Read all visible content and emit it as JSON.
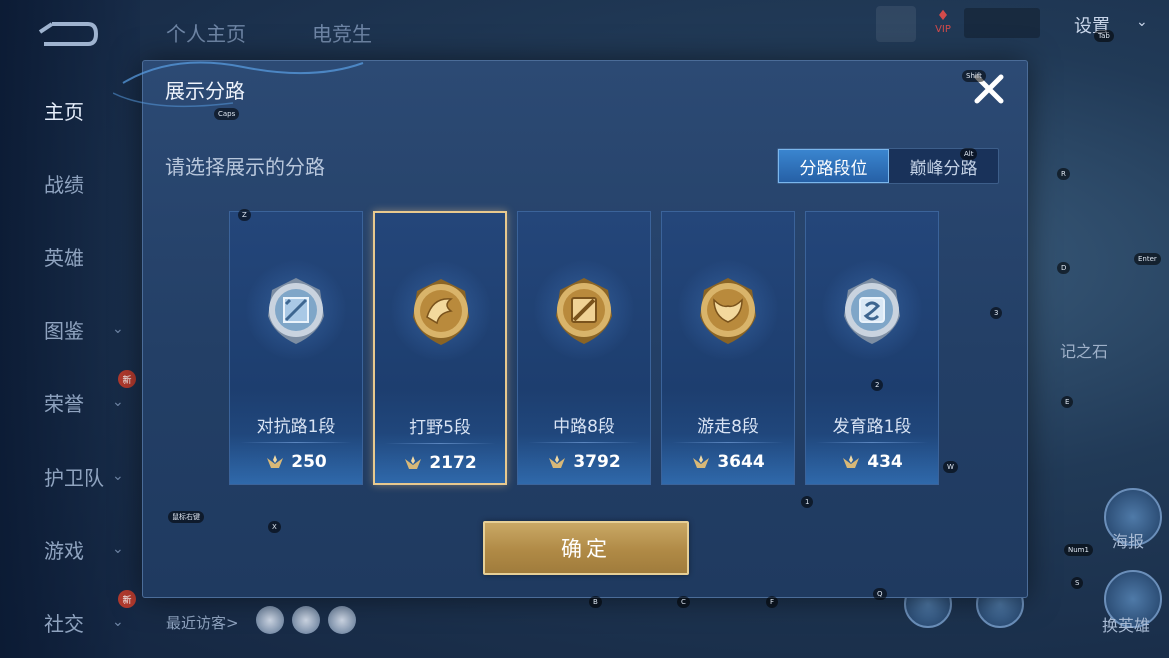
{
  "leftnav": {
    "items": [
      {
        "label": "主页",
        "chevron": false,
        "badge": ""
      },
      {
        "label": "战绩",
        "chevron": false,
        "badge": ""
      },
      {
        "label": "英雄",
        "chevron": false,
        "badge": ""
      },
      {
        "label": "图鉴",
        "chevron": true,
        "badge": ""
      },
      {
        "label": "荣誉",
        "chevron": true,
        "badge": "新"
      },
      {
        "label": "护卫队",
        "chevron": true,
        "badge": ""
      },
      {
        "label": "游戏",
        "chevron": true,
        "badge": ""
      },
      {
        "label": "社交",
        "chevron": true,
        "badge": "新"
      }
    ]
  },
  "topbar": {
    "tabs": [
      "个人主页",
      "电竞生"
    ],
    "settings_label": "设置",
    "vip_label": "VIP"
  },
  "footer": {
    "recent_visitors_label": "最近访客>"
  },
  "right_side": {
    "stone_label": "记之石",
    "report_label": "海报",
    "swap_label": "换英雄"
  },
  "dialog": {
    "title": "展示分路",
    "subtitle": "请选择展示的分路",
    "segments": [
      {
        "label": "分路段位",
        "active": true
      },
      {
        "label": "巅峰分路",
        "active": false
      }
    ],
    "cards": [
      {
        "lane": "对抗路1段",
        "score": "250",
        "emblem": "clash-lane-icon",
        "tier": "silver",
        "selected": false
      },
      {
        "lane": "打野5段",
        "score": "2172",
        "emblem": "jungle-dragon-icon",
        "tier": "gold",
        "selected": true
      },
      {
        "lane": "中路8段",
        "score": "3792",
        "emblem": "mid-lane-icon",
        "tier": "gold",
        "selected": false
      },
      {
        "lane": "游走8段",
        "score": "3644",
        "emblem": "roam-wings-icon",
        "tier": "gold",
        "selected": false
      },
      {
        "lane": "发育路1段",
        "score": "434",
        "emblem": "farm-lane-icon",
        "tier": "silver",
        "selected": false
      }
    ],
    "confirm_label": "确定"
  },
  "key_hints": {
    "caps": "Caps",
    "shift": "Shift",
    "tab": "Tab",
    "alt": "Alt",
    "z": "Z",
    "x": "X",
    "r": "R",
    "d": "D",
    "enter": "Enter",
    "three": "3",
    "two": "2",
    "e": "E",
    "w": "W",
    "one": "1",
    "num1": "Num1",
    "s": "S",
    "q": "Q",
    "b": "B",
    "c": "C",
    "f": "F",
    "rclick": "鼠标右键"
  },
  "colors": {
    "gold": "#e8c98e",
    "accent_blue": "#2f74be",
    "confirm_gold": "#b8934e"
  }
}
